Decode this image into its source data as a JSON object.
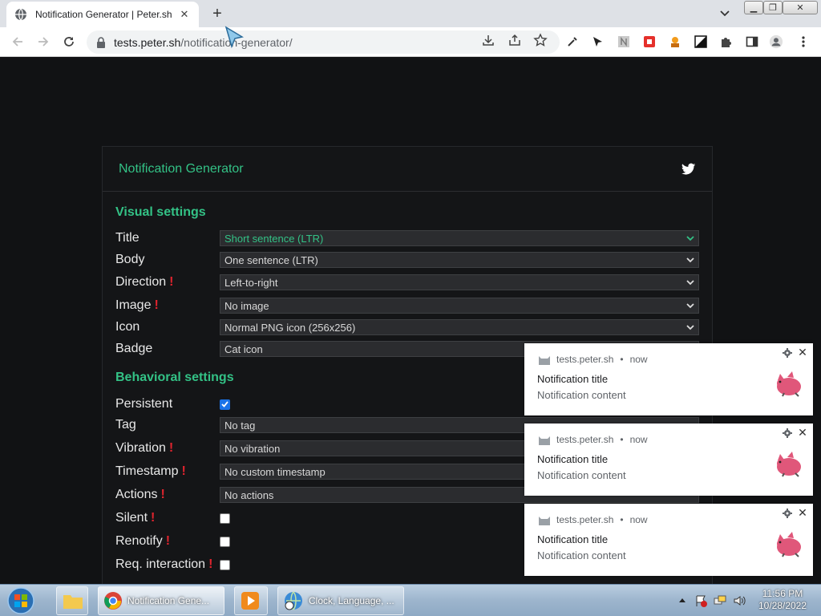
{
  "browser": {
    "tab_title": "Notification Generator | Peter.sh",
    "url_host": "tests.peter.sh",
    "url_path": "/notification-generator/"
  },
  "page": {
    "header_title": "Notification Generator",
    "visual_heading": "Visual settings",
    "behavioral_heading": "Behavioral settings",
    "visual": [
      {
        "label": "Title",
        "value": "Short sentence (LTR)",
        "warn": false
      },
      {
        "label": "Body",
        "value": "One sentence (LTR)",
        "warn": false
      },
      {
        "label": "Direction",
        "value": "Left-to-right",
        "warn": true
      },
      {
        "label": "Image",
        "value": "No image",
        "warn": true
      },
      {
        "label": "Icon",
        "value": "Normal PNG icon (256x256)",
        "warn": false
      },
      {
        "label": "Badge",
        "value": "Cat icon",
        "warn": false
      }
    ],
    "behavioral": [
      {
        "label": "Persistent",
        "checked": true,
        "warn": false
      },
      {
        "label": "Tag",
        "value": "No tag",
        "warn": false
      },
      {
        "label": "Vibration",
        "value": "No vibration",
        "warn": true
      },
      {
        "label": "Timestamp",
        "value": "No custom timestamp",
        "warn": true
      },
      {
        "label": "Actions",
        "value": "No actions",
        "warn": true
      },
      {
        "label": "Silent",
        "checked": false,
        "warn": true
      },
      {
        "label": "Renotify",
        "checked": false,
        "warn": true
      },
      {
        "label": "Req. interaction",
        "checked": false,
        "warn": true
      }
    ]
  },
  "notifications": [
    {
      "origin": "tests.peter.sh",
      "time": "now",
      "title": "Notification title",
      "body": "Notification content"
    },
    {
      "origin": "tests.peter.sh",
      "time": "now",
      "title": "Notification title",
      "body": "Notification content"
    },
    {
      "origin": "tests.peter.sh",
      "time": "now",
      "title": "Notification title",
      "body": "Notification content"
    }
  ],
  "taskbar": {
    "items": [
      "Notification Gene...",
      "Clock, Language, ..."
    ],
    "time": "11:56 PM",
    "date": "10/28/2022"
  },
  "colors": {
    "accent": "#33c286",
    "warn": "#e0242e",
    "page_bg": "#111214"
  }
}
